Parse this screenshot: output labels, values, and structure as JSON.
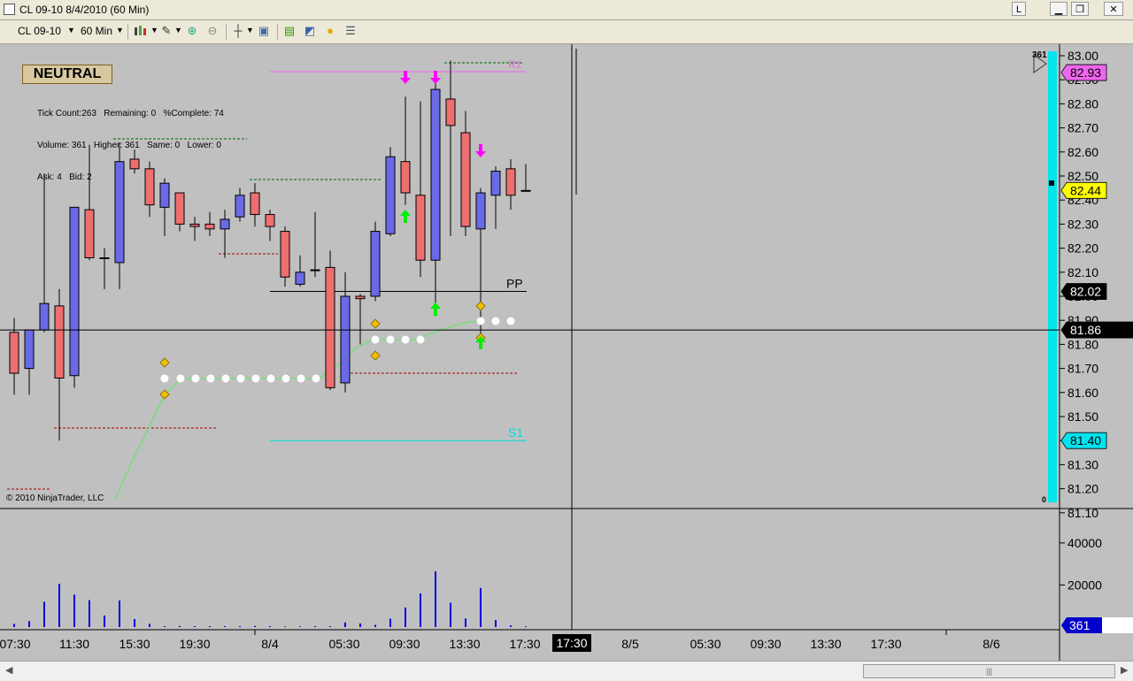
{
  "window": {
    "title": "CL 09-10  8/4/2010 (60 Min)",
    "buttons": {
      "l_label": "L",
      "minimize": "▁",
      "maximize": "❐",
      "close": "✕"
    }
  },
  "toolbar": {
    "instrument": "CL 09-10",
    "interval": "60 Min",
    "icons": [
      "bar-type-icon",
      "draw-pencil-icon",
      "zoom-in-icon",
      "zoom-out-icon",
      "crosshair-icon",
      "properties-icon",
      "data-series-icon",
      "indicators-icon",
      "strategies-icon",
      "data-box-icon"
    ]
  },
  "overlay": {
    "bias": "NEUTRAL",
    "stats": [
      "Tick Count:263   Remaining: 0   %Complete: 74",
      "Volume: 361   Higher: 361   Same: 0   Lower: 0",
      "Ask: 4   Bid: 2"
    ],
    "copyright": "© 2010 NinjaTrader, LLC"
  },
  "colors": {
    "background": "#c0c0c0",
    "up_candle": "#6a6ae6",
    "down_candle": "#ee6f6f",
    "volume": "#0000dd",
    "cyan_bar": "#00e5ee"
  },
  "chart_data": {
    "type": "candlestick",
    "instrument": "CL 09-10",
    "interval": "60 Min",
    "ylim": [
      81.03,
      83.07
    ],
    "yticks": [
      "83.00",
      "82.90",
      "82.80",
      "82.70",
      "82.60",
      "82.50",
      "82.40",
      "82.30",
      "82.20",
      "82.10",
      "82.00",
      "81.90",
      "81.80",
      "81.70",
      "81.60",
      "81.50",
      "81.40",
      "81.30",
      "81.20",
      "81.10"
    ],
    "candles": [
      {
        "o": 81.85,
        "h": 81.91,
        "l": 81.59,
        "c": 81.68
      },
      {
        "o": 81.7,
        "h": 81.86,
        "l": 81.59,
        "c": 81.86
      },
      {
        "o": 81.86,
        "h": 82.51,
        "l": 81.85,
        "c": 81.97
      },
      {
        "o": 81.96,
        "h": 82.03,
        "l": 81.4,
        "c": 81.66
      },
      {
        "o": 81.67,
        "h": 82.37,
        "l": 81.62,
        "c": 82.37
      },
      {
        "o": 82.36,
        "h": 82.63,
        "l": 82.15,
        "c": 82.16
      },
      {
        "o": 82.16,
        "h": 82.2,
        "l": 82.03,
        "c": 82.16
      },
      {
        "o": 82.14,
        "h": 82.64,
        "l": 82.03,
        "c": 82.56
      },
      {
        "o": 82.57,
        "h": 82.61,
        "l": 82.51,
        "c": 82.53
      },
      {
        "o": 82.53,
        "h": 82.56,
        "l": 82.33,
        "c": 82.38
      },
      {
        "o": 82.37,
        "h": 82.49,
        "l": 82.25,
        "c": 82.47
      },
      {
        "o": 82.43,
        "h": 82.43,
        "l": 82.27,
        "c": 82.3
      },
      {
        "o": 82.3,
        "h": 82.33,
        "l": 82.23,
        "c": 82.29
      },
      {
        "o": 82.3,
        "h": 82.35,
        "l": 82.25,
        "c": 82.28
      },
      {
        "o": 82.28,
        "h": 82.36,
        "l": 82.16,
        "c": 82.32
      },
      {
        "o": 82.33,
        "h": 82.45,
        "l": 82.31,
        "c": 82.42
      },
      {
        "o": 82.43,
        "h": 82.47,
        "l": 82.29,
        "c": 82.34
      },
      {
        "o": 82.34,
        "h": 82.36,
        "l": 82.23,
        "c": 82.29
      },
      {
        "o": 82.27,
        "h": 82.29,
        "l": 82.04,
        "c": 82.08
      },
      {
        "o": 82.05,
        "h": 82.17,
        "l": 82.04,
        "c": 82.1
      },
      {
        "o": 82.11,
        "h": 82.35,
        "l": 82.08,
        "c": 82.11
      },
      {
        "o": 82.12,
        "h": 82.19,
        "l": 81.61,
        "c": 81.62
      },
      {
        "o": 81.64,
        "h": 82.1,
        "l": 81.6,
        "c": 82.0
      },
      {
        "o": 82.0,
        "h": 82.01,
        "l": 81.8,
        "c": 81.99
      },
      {
        "o": 82.0,
        "h": 82.31,
        "l": 81.98,
        "c": 82.27
      },
      {
        "o": 82.26,
        "h": 82.62,
        "l": 82.25,
        "c": 82.58
      },
      {
        "o": 82.56,
        "h": 82.83,
        "l": 82.38,
        "c": 82.43
      },
      {
        "o": 82.42,
        "h": 82.81,
        "l": 82.08,
        "c": 82.15
      },
      {
        "o": 82.15,
        "h": 82.91,
        "l": 81.96,
        "c": 82.86
      },
      {
        "o": 82.82,
        "h": 82.98,
        "l": 82.25,
        "c": 82.71
      },
      {
        "o": 82.68,
        "h": 82.77,
        "l": 82.25,
        "c": 82.29
      },
      {
        "o": 82.28,
        "h": 82.45,
        "l": 81.8,
        "c": 82.43
      },
      {
        "o": 82.42,
        "h": 82.54,
        "l": 82.28,
        "c": 82.52
      },
      {
        "o": 82.53,
        "h": 82.57,
        "l": 82.36,
        "c": 82.42
      },
      {
        "o": 82.44,
        "h": 82.55,
        "l": 82.44,
        "c": 82.44
      }
    ],
    "volume": [
      1500,
      2800,
      12000,
      20500,
      15400,
      12800,
      5500,
      12600,
      3800,
      1500,
      400,
      500,
      400,
      400,
      400,
      400,
      500,
      400,
      300,
      300,
      400,
      400,
      2200,
      1700,
      1000,
      4000,
      9300,
      16000,
      26500,
      11500,
      4100,
      18600,
      3300,
      800,
      361
    ],
    "volume_ticks": [
      "40000",
      "20000"
    ],
    "x_labels": [
      "07:30",
      "11:30",
      "15:30",
      "19:30",
      "8/4",
      "05:30",
      "09:30",
      "13:30",
      "17:30",
      "17:30",
      "8/5",
      "05:30",
      "09:30",
      "13:30",
      "17:30",
      "8/6"
    ],
    "levels": {
      "PP": {
        "label": "PP",
        "value": 82.02
      },
      "S1": {
        "label": "S1",
        "value": 81.4
      },
      "R1": {
        "label": "R1",
        "value": 82.98
      }
    },
    "price_markers": [
      {
        "label": "82.93",
        "value": 82.93,
        "bg": "#ee66ee"
      },
      {
        "label": "82.44",
        "value": 82.44,
        "bg": "#ffff00"
      },
      {
        "label": "82.02",
        "value": 82.02,
        "bg": "#000000"
      },
      {
        "label": "81.86",
        "value": 81.86,
        "bg": "#000000"
      },
      {
        "label": "81.40",
        "value": 81.4,
        "bg": "#00e5ee"
      }
    ],
    "crosshair": {
      "price": "81.86",
      "time": "17:30"
    },
    "volume_marker": "361",
    "tick_counter": {
      "top": "361",
      "bottom": "0"
    }
  }
}
